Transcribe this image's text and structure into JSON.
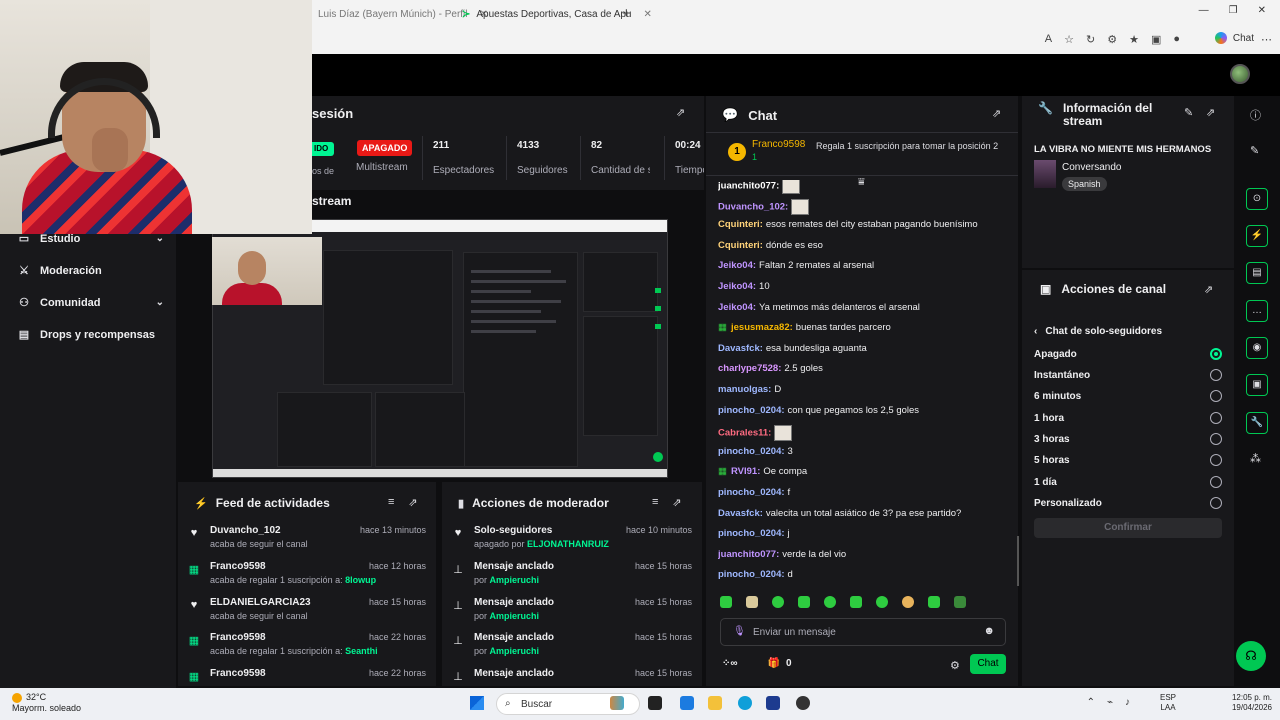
{
  "browser": {
    "tabs": [
      {
        "label": "Luis Díaz (Bayern Múnich) - Perfil",
        "state": "inactive"
      },
      {
        "label": "Apuestas Deportivas, Casa de Apu",
        "state": "active"
      }
    ],
    "copilot_label": "Chat"
  },
  "left_nav": {
    "items": [
      {
        "label": "Estudio",
        "icon": "studio-icon",
        "expandable": true
      },
      {
        "label": "Moderación",
        "icon": "moderation-icon",
        "expandable": false
      },
      {
        "label": "Comunidad",
        "icon": "community-icon",
        "expandable": true
      },
      {
        "label": "Drops y recompensas",
        "icon": "drops-icon",
        "expandable": false
      }
    ]
  },
  "session": {
    "title": "sesión",
    "live_label": "IDO",
    "status_badge": "APAGADO",
    "multistream_label": "Multistream",
    "left_sub_label": "os de",
    "stats": [
      {
        "value": "211",
        "label": "Espectadores"
      },
      {
        "value": "4133",
        "label": "Seguidores"
      },
      {
        "value": "82",
        "label": "Cantidad de suscripciones"
      },
      {
        "value": "00:24",
        "label": "Tiempo en vivo"
      }
    ]
  },
  "preview": {
    "title": "stream"
  },
  "activity_feed": {
    "title": "Feed de actividades",
    "items": [
      {
        "icon": "heart-icon",
        "name": "Duvancho_102",
        "sub": "acaba de seguir el canal",
        "highlight": "",
        "time": "hace 13 minutos"
      },
      {
        "icon": "gift-icon",
        "name": "Franco9598",
        "sub": "acaba de regalar 1 suscripción a: ",
        "highlight": "8lowup",
        "time": "hace 12 horas"
      },
      {
        "icon": "heart-icon",
        "name": "ELDANIELGARCIA23",
        "sub": "acaba de seguir el canal",
        "highlight": "",
        "time": "hace 15 horas"
      },
      {
        "icon": "gift-icon",
        "name": "Franco9598",
        "sub": "acaba de regalar 1 suscripción a: ",
        "highlight": "Seanthi",
        "time": "hace 22 horas"
      },
      {
        "icon": "gift-icon",
        "name": "Franco9598",
        "sub": "",
        "highlight": "",
        "time": "hace 22 horas"
      }
    ]
  },
  "mod_actions": {
    "title": "Acciones de moderador",
    "items": [
      {
        "icon": "heart-icon",
        "name": "Solo-seguidores",
        "sub": "apagado por ",
        "highlight": "ELJONATHANRUIZ",
        "time": "hace 10 minutos"
      },
      {
        "icon": "pin-icon",
        "name": "Mensaje anclado",
        "sub": "por ",
        "highlight": "Ampieruchi",
        "time": "hace 15 horas"
      },
      {
        "icon": "pin-icon",
        "name": "Mensaje anclado",
        "sub": "por ",
        "highlight": "Ampieruchi",
        "time": "hace 15 horas"
      },
      {
        "icon": "pin-icon",
        "name": "Mensaje anclado",
        "sub": "por ",
        "highlight": "Ampieruchi",
        "time": "hace 15 horas"
      },
      {
        "icon": "pin-icon",
        "name": "Mensaje anclado",
        "sub": "",
        "highlight": "",
        "time": "hace 15 horas"
      }
    ]
  },
  "chat": {
    "title": "Chat",
    "gift": {
      "rank": "1",
      "user": "Franco9598",
      "count": "1",
      "text": "Regala 1 suscripción para tomar la posición 2"
    },
    "messages": [
      {
        "user": "juanchito077:",
        "text": "",
        "color": "#ffffff",
        "emote": true
      },
      {
        "user": "Duvancho_102:",
        "text": "",
        "color": "#bf94ff",
        "emote": true
      },
      {
        "user": "Cquinteri:",
        "text": "esos remates del city estaban pagando buenísimo",
        "color": "#ffd37a",
        "emote": false
      },
      {
        "user": "Cquinteri:",
        "text": "dónde es eso",
        "color": "#ffd37a",
        "emote": false
      },
      {
        "user": "Jeiko04:",
        "text": "Faltan 2 remates al arsenal",
        "color": "#bf94ff",
        "emote": false
      },
      {
        "user": "Jeiko04:",
        "text": "10",
        "color": "#bf94ff",
        "emote": false
      },
      {
        "user": "Jeiko04:",
        "text": "Ya metimos más delanteros el arsenal",
        "color": "#bf94ff",
        "emote": false
      },
      {
        "user": "jesusmaza82:",
        "text": "buenas tardes parcero",
        "color": "#f5b700",
        "emote": false,
        "badge": true
      },
      {
        "user": "Davasfck:",
        "text": "esa bundesliga aguanta",
        "color": "#9fb8ff",
        "emote": false
      },
      {
        "user": "charlype7528:",
        "text": "2.5 goles",
        "color": "#d896ff",
        "emote": false
      },
      {
        "user": "manuolgas:",
        "text": "D",
        "color": "#9fb8ff",
        "emote": false
      },
      {
        "user": "pinocho_0204:",
        "text": "con que pegamos los 2,5 goles",
        "color": "#9fb8ff",
        "emote": false
      },
      {
        "user": "Cabrales11:",
        "text": "",
        "color": "#ff6b81",
        "emote": true
      },
      {
        "user": "pinocho_0204:",
        "text": "3",
        "color": "#9fb8ff",
        "emote": false
      },
      {
        "user": "RVI91:",
        "text": "Oe compa",
        "color": "#bf94ff",
        "emote": false,
        "badge": true
      },
      {
        "user": "pinocho_0204:",
        "text": "f",
        "color": "#9fb8ff",
        "emote": false
      },
      {
        "user": "Davasfck:",
        "text": "valecita un total asiático de 3? pa ese partido?",
        "color": "#9fb8ff",
        "emote": false
      },
      {
        "user": "pinocho_0204:",
        "text": "j",
        "color": "#9fb8ff",
        "emote": false
      },
      {
        "user": "juanchito077:",
        "text": "verde la del vio",
        "color": "#bf94ff",
        "emote": false
      },
      {
        "user": "pinocho_0204:",
        "text": "d",
        "color": "#9fb8ff",
        "emote": false
      }
    ],
    "input_placeholder": "Enviar un mensaje",
    "points": "0",
    "send_label": "Chat"
  },
  "stream_info": {
    "title": "Información del stream",
    "stream_title": "LA VIBRA NO MIENTE MIS HERMANOS",
    "category": "Conversando",
    "language": "Spanish"
  },
  "channel_actions": {
    "title": "Acciones de canal",
    "back_label": "Chat de solo-seguidores",
    "options": [
      {
        "label": "Apagado",
        "selected": true
      },
      {
        "label": "Instantáneo",
        "selected": false
      },
      {
        "label": "6 minutos",
        "selected": false
      },
      {
        "label": "1 hora",
        "selected": false
      },
      {
        "label": "3 horas",
        "selected": false
      },
      {
        "label": "5 horas",
        "selected": false
      },
      {
        "label": "1 día",
        "selected": false
      },
      {
        "label": "Personalizado",
        "selected": false
      }
    ],
    "confirm_label": "Confirmar"
  },
  "taskbar": {
    "weather_temp": "32°C",
    "weather_desc": "Mayorm. soleado",
    "search_label": "Buscar",
    "lang_1": "ESP",
    "lang_2": "LAA",
    "time": "12:05 p. m.",
    "date": "19/04/2026"
  },
  "colors": {
    "accent_green": "#00f593",
    "brand_button": "#00c853",
    "offline_red": "#e91916"
  }
}
